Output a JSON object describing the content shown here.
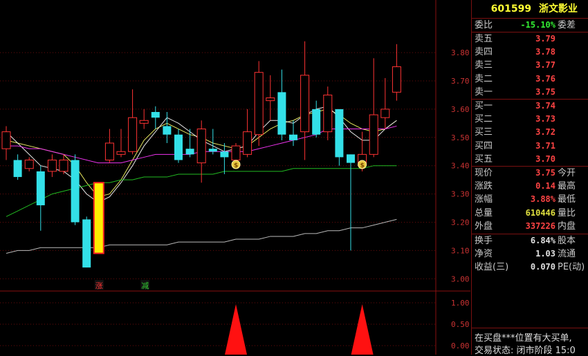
{
  "chart_data": {
    "type": "candlestick",
    "y_ticks": [
      "3.80",
      "3.70",
      "3.60",
      "3.50",
      "3.40",
      "3.30",
      "3.20",
      "3.10",
      "3.00"
    ],
    "ylim": [
      2.93,
      3.86
    ],
    "candles": [
      {
        "o": 3.46,
        "c": 3.52,
        "h": 3.54,
        "l": 3.42
      },
      {
        "o": 3.42,
        "c": 3.36,
        "h": 3.44,
        "l": 3.35
      },
      {
        "o": 3.39,
        "c": 3.42,
        "h": 3.43,
        "l": 3.38
      },
      {
        "o": 3.38,
        "c": 3.26,
        "h": 3.4,
        "l": 3.17
      },
      {
        "o": 3.38,
        "c": 3.42,
        "h": 3.44,
        "l": 3.36
      },
      {
        "o": 3.38,
        "c": 3.42,
        "h": 3.44,
        "l": 3.37
      },
      {
        "o": 3.42,
        "c": 3.2,
        "h": 3.44,
        "l": 3.19
      },
      {
        "o": 3.21,
        "c": 3.04,
        "h": 3.22,
        "l": 3.04
      },
      {
        "o": 3.09,
        "c": 3.34,
        "h": 3.34,
        "l": 3.09
      },
      {
        "o": 3.42,
        "c": 3.48,
        "h": 3.53,
        "l": 3.41
      },
      {
        "o": 3.44,
        "c": 3.45,
        "h": 3.53,
        "l": 3.43
      },
      {
        "o": 3.45,
        "c": 3.57,
        "h": 3.67,
        "l": 3.44
      },
      {
        "o": 3.55,
        "c": 3.56,
        "h": 3.6,
        "l": 3.53
      },
      {
        "o": 3.59,
        "c": 3.57,
        "h": 3.61,
        "l": 3.53
      },
      {
        "o": 3.54,
        "c": 3.51,
        "h": 3.59,
        "l": 3.48
      },
      {
        "o": 3.51,
        "c": 3.42,
        "h": 3.53,
        "l": 3.41
      },
      {
        "o": 3.46,
        "c": 3.44,
        "h": 3.53,
        "l": 3.43
      },
      {
        "o": 3.41,
        "c": 3.53,
        "h": 3.56,
        "l": 3.34
      },
      {
        "o": 3.46,
        "c": 3.45,
        "h": 3.53,
        "l": 3.44
      },
      {
        "o": 3.45,
        "c": 3.43,
        "h": 3.48,
        "l": 3.37
      },
      {
        "o": 3.42,
        "c": 3.47,
        "h": 3.48,
        "l": 3.39
      },
      {
        "o": 3.44,
        "c": 3.52,
        "h": 3.6,
        "l": 3.43
      },
      {
        "o": 3.51,
        "c": 3.73,
        "h": 3.77,
        "l": 3.47
      },
      {
        "o": 3.63,
        "c": 3.64,
        "h": 3.72,
        "l": 3.56
      },
      {
        "o": 3.66,
        "c": 3.51,
        "h": 3.74,
        "l": 3.49
      },
      {
        "o": 3.51,
        "c": 3.49,
        "h": 3.56,
        "l": 3.47
      },
      {
        "o": 3.52,
        "c": 3.72,
        "h": 3.84,
        "l": 3.42
      },
      {
        "o": 3.6,
        "c": 3.51,
        "h": 3.63,
        "l": 3.5
      },
      {
        "o": 3.52,
        "c": 3.65,
        "h": 3.68,
        "l": 3.49
      },
      {
        "o": 3.6,
        "c": 3.43,
        "h": 3.6,
        "l": 3.4
      },
      {
        "o": 3.44,
        "c": 3.41,
        "h": 3.44,
        "l": 3.1
      },
      {
        "o": 3.41,
        "c": 3.44,
        "h": 3.52,
        "l": 3.38
      },
      {
        "o": 3.44,
        "c": 3.58,
        "h": 3.78,
        "l": 3.43
      },
      {
        "o": 3.57,
        "c": 3.6,
        "h": 3.71,
        "l": 3.53
      },
      {
        "o": 3.66,
        "c": 3.75,
        "h": 3.83,
        "l": 3.63
      }
    ],
    "ma_lines": {
      "yellow": [
        3.49,
        3.48,
        3.47,
        3.46,
        3.45,
        3.44,
        3.4,
        3.34,
        3.29,
        3.3,
        3.35,
        3.42,
        3.49,
        3.53,
        3.55,
        3.53,
        3.51,
        3.5,
        3.48,
        3.47,
        3.46,
        3.47,
        3.5,
        3.53,
        3.55,
        3.56,
        3.58,
        3.59,
        3.6,
        3.58,
        3.55,
        3.53,
        3.52,
        3.53,
        3.56
      ],
      "white": [
        3.52,
        3.48,
        3.44,
        3.4,
        3.39,
        3.38,
        3.35,
        3.3,
        3.27,
        3.29,
        3.34,
        3.4,
        3.47,
        3.52,
        3.57,
        3.55,
        3.52,
        3.49,
        3.47,
        3.45,
        3.46,
        3.47,
        3.52,
        3.56,
        3.56,
        3.55,
        3.58,
        3.6,
        3.61,
        3.57,
        3.52,
        3.49,
        3.49,
        3.53,
        3.56
      ],
      "magenta": [
        3.47,
        3.47,
        3.46,
        3.46,
        3.45,
        3.44,
        3.43,
        3.42,
        3.41,
        3.41,
        3.41,
        3.42,
        3.43,
        3.44,
        3.44,
        3.44,
        3.44,
        3.45,
        3.45,
        3.45,
        3.45,
        3.45,
        3.46,
        3.47,
        3.48,
        3.49,
        3.5,
        3.51,
        3.53,
        3.53,
        3.53,
        3.53,
        3.53,
        3.53,
        3.54
      ],
      "green": [
        3.22,
        3.24,
        3.26,
        3.28,
        3.3,
        3.31,
        3.32,
        3.33,
        3.34,
        3.34,
        3.35,
        3.35,
        3.36,
        3.36,
        3.36,
        3.37,
        3.37,
        3.37,
        3.37,
        3.38,
        3.38,
        3.38,
        3.38,
        3.38,
        3.38,
        3.39,
        3.39,
        3.39,
        3.39,
        3.39,
        3.39,
        3.39,
        3.4,
        3.4,
        3.4
      ],
      "gray": [
        3.09,
        3.1,
        3.1,
        3.11,
        3.11,
        3.11,
        3.11,
        3.11,
        3.11,
        3.12,
        3.12,
        3.12,
        3.12,
        3.12,
        3.12,
        3.13,
        3.13,
        3.13,
        3.13,
        3.13,
        3.14,
        3.14,
        3.14,
        3.15,
        3.15,
        3.15,
        3.16,
        3.16,
        3.17,
        3.17,
        3.18,
        3.18,
        3.19,
        3.2,
        3.21
      ]
    },
    "markers": [
      {
        "index": 8,
        "label": "涨",
        "color": "#ff3333"
      },
      {
        "index": 12,
        "label": "减",
        "color": "#33cc33"
      }
    ],
    "coin_markers": [
      20,
      31
    ],
    "sub_ticks": [
      "1.00",
      "0.50",
      "0.00"
    ],
    "sub_spikes": [
      20,
      31
    ]
  },
  "panel": {
    "code": "601599",
    "name": "浙文影业",
    "weibi_label": "委比",
    "weibi_value": "-15.10%",
    "weicha_label": "委差",
    "sells": [
      {
        "label": "卖五",
        "price": "3.79"
      },
      {
        "label": "卖四",
        "price": "3.78"
      },
      {
        "label": "卖三",
        "price": "3.77"
      },
      {
        "label": "卖二",
        "price": "3.76"
      },
      {
        "label": "卖一",
        "price": "3.75"
      }
    ],
    "buys": [
      {
        "label": "买一",
        "price": "3.74"
      },
      {
        "label": "买二",
        "price": "3.73"
      },
      {
        "label": "买三",
        "price": "3.72"
      },
      {
        "label": "买四",
        "price": "3.71"
      },
      {
        "label": "买五",
        "price": "3.70"
      }
    ],
    "stats": [
      {
        "label": "现价",
        "value": "3.75",
        "color": "#ff4444",
        "label2": "今开"
      },
      {
        "label": "涨跌",
        "value": "0.14",
        "color": "#ff4444",
        "label2": "最高"
      },
      {
        "label": "涨幅",
        "value": "3.88%",
        "color": "#ff4444",
        "label2": "最低"
      },
      {
        "label": "总量",
        "value": "610446",
        "color": "#e0e040",
        "label2": "量比"
      },
      {
        "label": "外盘",
        "value": "337226",
        "color": "#ff4444",
        "label2": "内盘"
      }
    ],
    "stats2": [
      {
        "label": "换手",
        "value": "6.84%",
        "color": "#e0e0e0",
        "label2": "股本"
      },
      {
        "label": "净资",
        "value": "1.03",
        "color": "#e0e0e0",
        "label2": "流通"
      },
      {
        "label": "收益(三)",
        "value": "0.070",
        "color": "#e0e0e0",
        "label2": "PE(动)"
      }
    ],
    "message1": "在买盘***位置有大买单,",
    "message2": "交易状态: 闭市阶段 15:0"
  }
}
